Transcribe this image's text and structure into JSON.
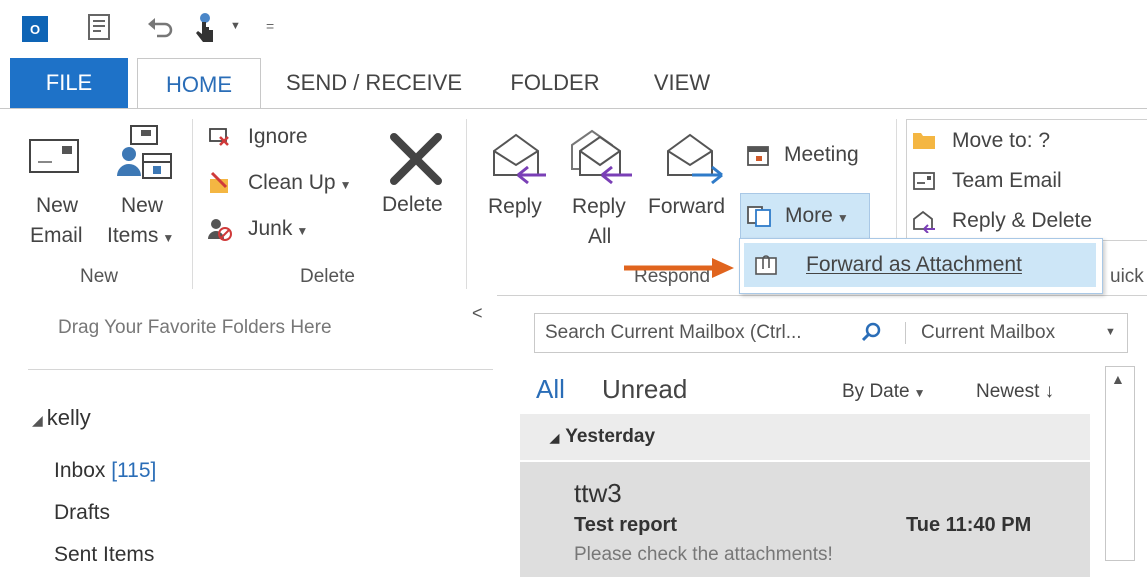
{
  "qat": {
    "app_icon": "outlook-icon",
    "app_icon_text": "O",
    "icons": [
      "new-items-icon",
      "undo-icon",
      "touch-mode-icon",
      "customize-icon"
    ]
  },
  "tabs": {
    "file": "FILE",
    "home": "HOME",
    "send_receive": "SEND / RECEIVE",
    "folder": "FOLDER",
    "view": "VIEW"
  },
  "ribbon": {
    "new_group": {
      "new_email_line1": "New",
      "new_email_line2": "Email",
      "new_items_line1": "New",
      "new_items_line2": "Items",
      "label": "New"
    },
    "delete_group": {
      "ignore": "Ignore",
      "clean_up": "Clean Up",
      "junk": "Junk",
      "delete": "Delete",
      "label": "Delete"
    },
    "respond_group": {
      "reply": "Reply",
      "reply_all_line1": "Reply",
      "reply_all_line2": "All",
      "forward": "Forward",
      "meeting": "Meeting",
      "more": "More",
      "label": "Respond"
    },
    "quick_steps": {
      "move_to": "Move to: ?",
      "team_email": "Team Email",
      "reply_delete": "Reply & Delete",
      "label_partial": "uick"
    }
  },
  "more_menu": {
    "forward_as_attachment": "Forward as Attachment"
  },
  "left_pane": {
    "favorites_hint": "Drag Your Favorite Folders Here",
    "collapse_glyph": "<",
    "account": "kelly",
    "folders": [
      {
        "name": "Inbox",
        "count": "[115]"
      },
      {
        "name": "Drafts",
        "count": ""
      },
      {
        "name": "Sent Items",
        "count": ""
      }
    ]
  },
  "mail_list": {
    "search_placeholder": "Search Current Mailbox (Ctrl...",
    "scope": "Current Mailbox",
    "filter_all": "All",
    "filter_unread": "Unread",
    "sort_by": "By Date",
    "order": "Newest",
    "group_header": "Yesterday",
    "items": [
      {
        "sender": "ttw3",
        "subject": "Test report",
        "time": "Tue 11:40 PM",
        "preview": "Please check the attachments!"
      }
    ]
  },
  "colors": {
    "file_tab": "#1e72c8",
    "active_tab_text": "#2a6db7",
    "link_blue": "#2a6db7",
    "selected_highlight": "#cde6f7",
    "arrow": "#e0641e",
    "selected_mail_bg": "#dedede"
  }
}
